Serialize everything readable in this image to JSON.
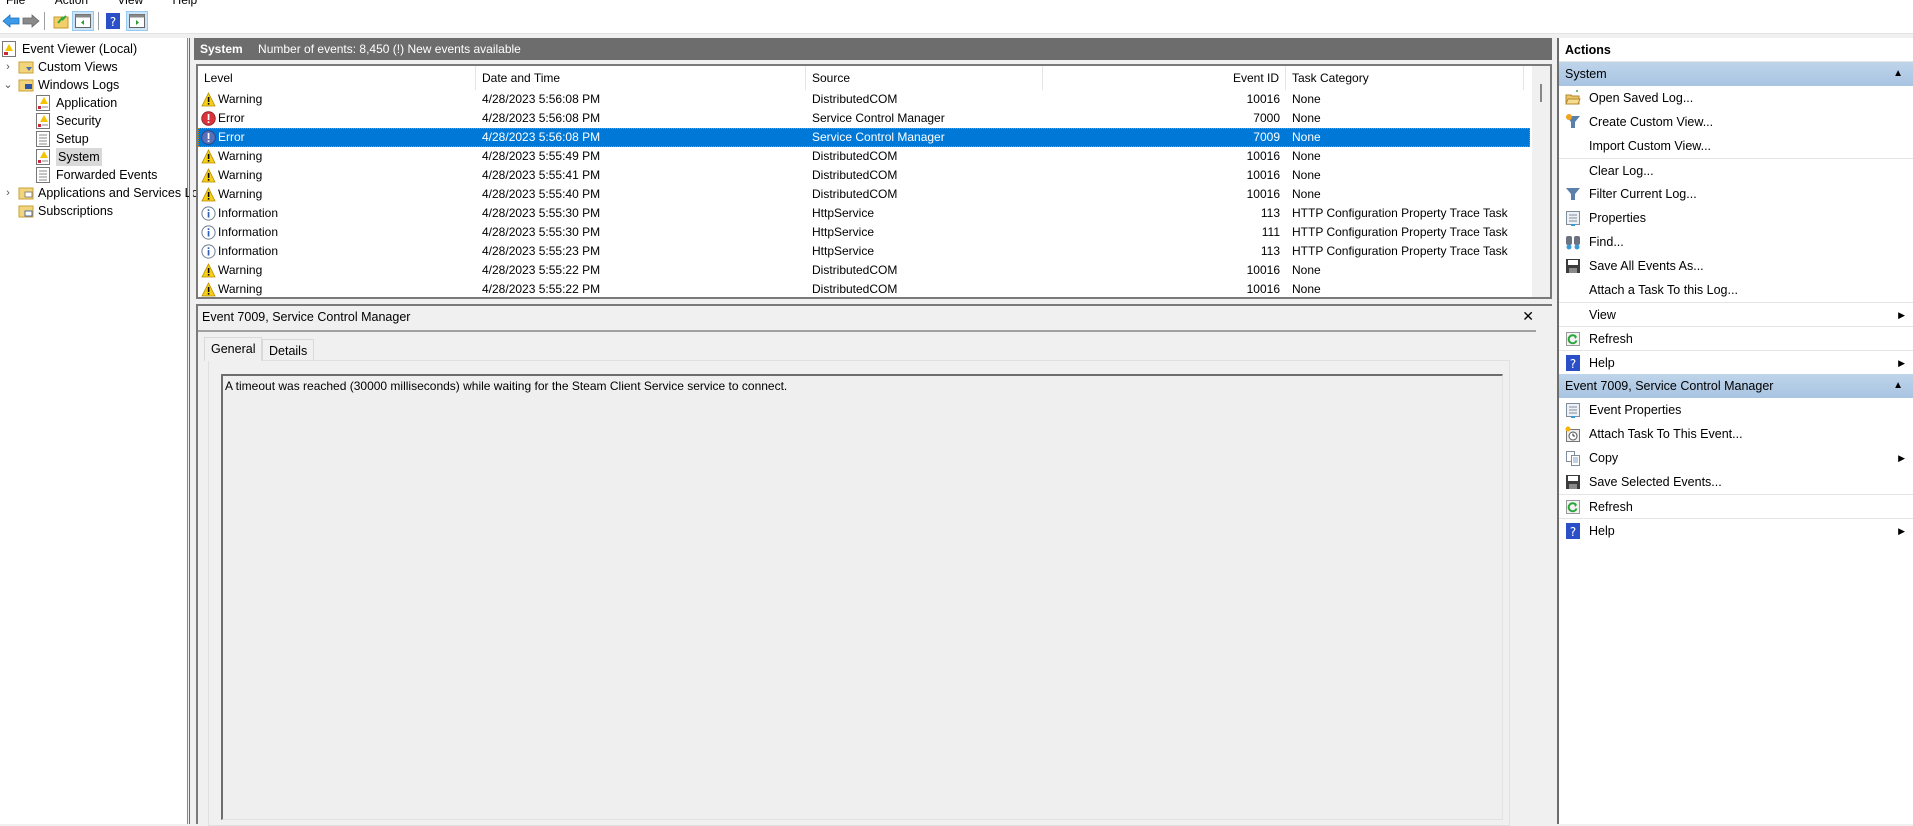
{
  "menubar": [
    "File",
    "Action",
    "View",
    "Help"
  ],
  "toolbar": {
    "buttons": [
      "back-icon",
      "forward-icon",
      "up-folder-icon",
      "show-hide-console-tree-icon",
      "help-icon",
      "show-hide-action-pane-icon"
    ]
  },
  "tree": {
    "root": "Event Viewer (Local)",
    "items": [
      {
        "label": "Custom Views",
        "expander": "›"
      },
      {
        "label": "Windows Logs",
        "expander": "⌄"
      },
      {
        "label": "Application"
      },
      {
        "label": "Security"
      },
      {
        "label": "Setup"
      },
      {
        "label": "System",
        "selected": true
      },
      {
        "label": "Forwarded Events"
      },
      {
        "label": "Applications and Services Lo",
        "expander": "›"
      },
      {
        "label": "Subscriptions"
      }
    ]
  },
  "header": {
    "log_name": "System",
    "summary": "Number of events: 8,450 (!) New events available"
  },
  "list": {
    "columns": [
      "Level",
      "Date and Time",
      "Source",
      "Event ID",
      "Task Category"
    ],
    "rows": [
      {
        "level": "Warning",
        "datetime": "4/28/2023 5:56:08 PM",
        "source": "DistributedCOM",
        "event_id": "10016",
        "task": "None"
      },
      {
        "level": "Error",
        "datetime": "4/28/2023 5:56:08 PM",
        "source": "Service Control Manager",
        "event_id": "7000",
        "task": "None"
      },
      {
        "level": "Error",
        "datetime": "4/28/2023 5:56:08 PM",
        "source": "Service Control Manager",
        "event_id": "7009",
        "task": "None",
        "selected": true
      },
      {
        "level": "Warning",
        "datetime": "4/28/2023 5:55:49 PM",
        "source": "DistributedCOM",
        "event_id": "10016",
        "task": "None"
      },
      {
        "level": "Warning",
        "datetime": "4/28/2023 5:55:41 PM",
        "source": "DistributedCOM",
        "event_id": "10016",
        "task": "None"
      },
      {
        "level": "Warning",
        "datetime": "4/28/2023 5:55:40 PM",
        "source": "DistributedCOM",
        "event_id": "10016",
        "task": "None"
      },
      {
        "level": "Information",
        "datetime": "4/28/2023 5:55:30 PM",
        "source": "HttpService",
        "event_id": "113",
        "task": "HTTP Configuration Property Trace Task"
      },
      {
        "level": "Information",
        "datetime": "4/28/2023 5:55:30 PM",
        "source": "HttpService",
        "event_id": "111",
        "task": "HTTP Configuration Property Trace Task"
      },
      {
        "level": "Information",
        "datetime": "4/28/2023 5:55:23 PM",
        "source": "HttpService",
        "event_id": "113",
        "task": "HTTP Configuration Property Trace Task"
      },
      {
        "level": "Warning",
        "datetime": "4/28/2023 5:55:22 PM",
        "source": "DistributedCOM",
        "event_id": "10016",
        "task": "None"
      },
      {
        "level": "Warning",
        "datetime": "4/28/2023 5:55:22 PM",
        "source": "DistributedCOM",
        "event_id": "10016",
        "task": "None"
      }
    ]
  },
  "details": {
    "title": "Event 7009, Service Control Manager",
    "close": "✕",
    "tabs": [
      "General",
      "Details"
    ],
    "active_tab": "General",
    "message": "A timeout was reached (30000 milliseconds) while waiting for the Steam Client Service service to connect."
  },
  "actions": {
    "title": "Actions",
    "sections": [
      {
        "label": "System",
        "items": [
          {
            "label": "Open Saved Log...",
            "icon": "open-folder-icon"
          },
          {
            "label": "Create Custom View...",
            "icon": "filter-star-icon"
          },
          {
            "label": "Import Custom View...",
            "icon": ""
          },
          {
            "label": "Clear Log...",
            "icon": "",
            "sep": true
          },
          {
            "label": "Filter Current Log...",
            "icon": "filter-icon"
          },
          {
            "label": "Properties",
            "icon": "properties-icon"
          },
          {
            "label": "Find...",
            "icon": "binoculars-icon"
          },
          {
            "label": "Save All Events As...",
            "icon": "save-icon"
          },
          {
            "label": "Attach a Task To this Log...",
            "icon": ""
          },
          {
            "label": "View",
            "icon": "",
            "submenu": true,
            "sep": true
          },
          {
            "label": "Refresh",
            "icon": "refresh-icon",
            "sep": true
          },
          {
            "label": "Help",
            "icon": "help-icon",
            "submenu": true,
            "sep": true
          }
        ]
      },
      {
        "label": "Event 7009, Service Control Manager",
        "items": [
          {
            "label": "Event Properties",
            "icon": "properties-icon"
          },
          {
            "label": "Attach Task To This Event...",
            "icon": "task-clock-icon"
          },
          {
            "label": "Copy",
            "icon": "copy-icon",
            "submenu": true
          },
          {
            "label": "Save Selected Events...",
            "icon": "save-icon"
          },
          {
            "label": "Refresh",
            "icon": "refresh-icon",
            "sep": true
          },
          {
            "label": "Help",
            "icon": "help-icon",
            "submenu": true,
            "sep": true
          }
        ]
      }
    ]
  },
  "colors": {
    "selection": "#0078d7",
    "header_bar": "#6d6d6d",
    "action_section": "#b4cce6"
  }
}
